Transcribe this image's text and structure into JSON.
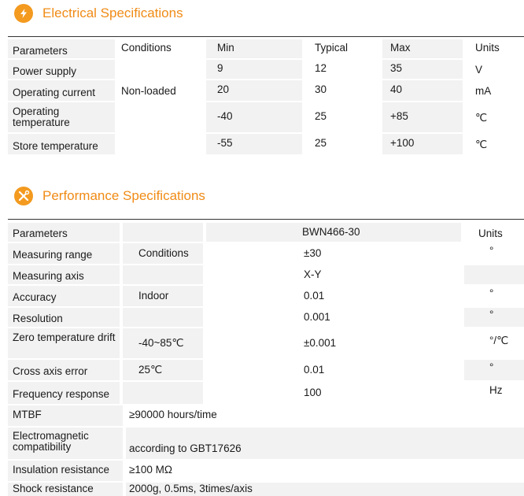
{
  "electrical": {
    "title": "Electrical Specifications",
    "icon": "lightning-icon",
    "columns": [
      "Parameters",
      "Conditions",
      "Min",
      "Typical",
      "Max",
      "Units"
    ],
    "rows": [
      {
        "param": "Power supply",
        "conditions": "",
        "min": "9",
        "typical": "12",
        "max": "35",
        "units": "V"
      },
      {
        "param": "Operating current",
        "conditions": "Non-loaded",
        "min": "20",
        "typical": "30",
        "max": "40",
        "units": "mA"
      },
      {
        "param": "Operating temperature",
        "conditions": "",
        "min": "-40",
        "typical": "25",
        "max": "+85",
        "units": "℃"
      },
      {
        "param": "Store temperature",
        "conditions": "",
        "min": "-55",
        "typical": "25",
        "max": "+100",
        "units": "℃"
      }
    ]
  },
  "performance": {
    "title": "Performance Specifications",
    "icon": "wrench-screwdriver-icon",
    "header": {
      "param": "Parameters",
      "model": "BWN466-30",
      "units": "Units"
    },
    "rows": [
      {
        "param": "Measuring range",
        "conditions": "Conditions",
        "value": "±30",
        "units": "°"
      },
      {
        "param": "Measuring axis",
        "conditions": "",
        "value": "X-Y",
        "units": ""
      },
      {
        "param": "Accuracy",
        "conditions": "Indoor",
        "value": "0.01",
        "units": "°"
      },
      {
        "param": "Resolution",
        "conditions": "",
        "value": "0.001",
        "units": "°"
      },
      {
        "param": "Zero temperature drift",
        "conditions": "-40~85℃",
        "value": "±0.001",
        "units": "°/℃"
      },
      {
        "param": "Cross axis error",
        "conditions": "25℃",
        "value": "0.01",
        "units": "°"
      },
      {
        "param": "Frequency response",
        "conditions": "",
        "value": "100",
        "units": "Hz"
      }
    ],
    "wide_rows": [
      {
        "param": "MTBF",
        "value": "≥90000 hours/time"
      },
      {
        "param": "Electromagnetic compatibility",
        "value": "according to GBT17626"
      },
      {
        "param": "Insulation resistance",
        "value": "≥100 MΩ"
      },
      {
        "param": "Shock resistance",
        "value": "2000g, 0.5ms, 3times/axis"
      }
    ]
  }
}
